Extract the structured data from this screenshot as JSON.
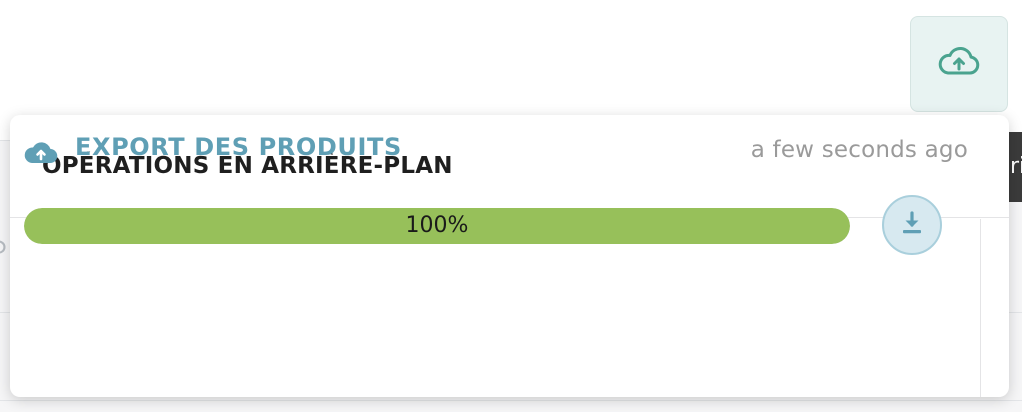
{
  "colors": {
    "accent": "#4aa38f",
    "title_blue": "#5f9fb5",
    "progress_fill": "#97c05a"
  },
  "toolbar": {
    "upload_toggle_icon": "cloud-upload-icon"
  },
  "panel": {
    "title": "OPÉRATIONS EN ARRIÈRE-PLAN",
    "operations": [
      {
        "icon": "cloud-upload-icon",
        "title": "EXPORT DES PRODUITS",
        "time": "a few seconds ago",
        "progress": 1.0,
        "progress_label": "100%",
        "action_icon": "download-icon"
      }
    ]
  }
}
